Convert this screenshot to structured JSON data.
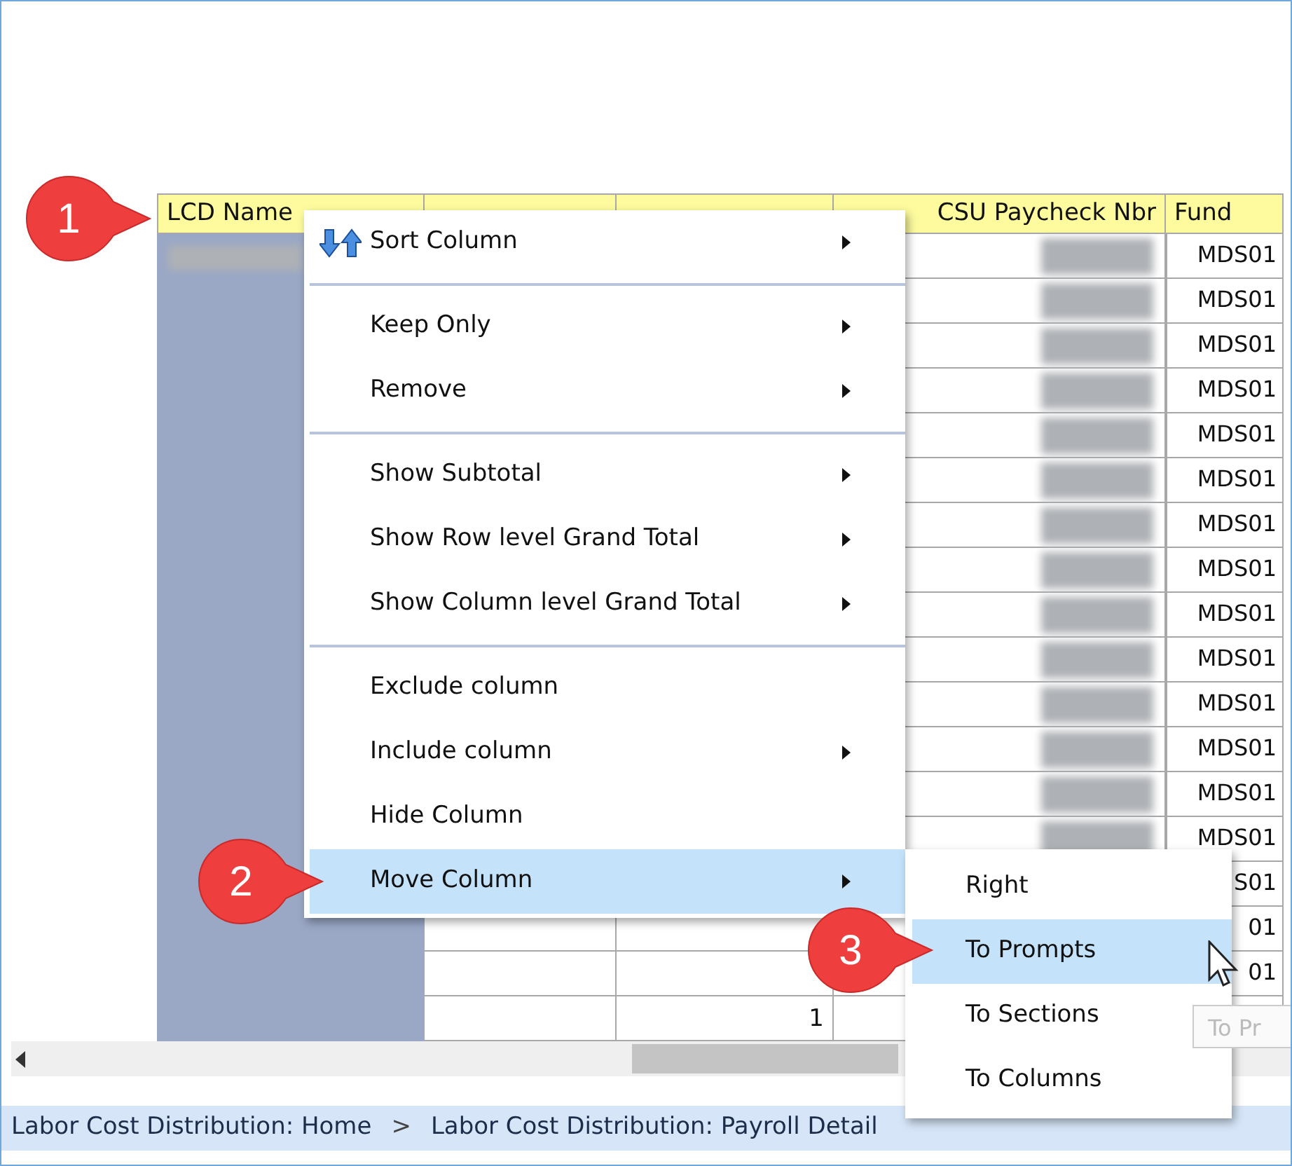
{
  "table": {
    "columns": [
      {
        "label": "LCD Name"
      },
      {},
      {},
      {
        "label": "CSU Paycheck Nbr"
      },
      {
        "label": "Fund"
      }
    ],
    "rows": [
      {
        "name_redacted": true,
        "paycheck_redacted": true,
        "fund": "MDS01"
      },
      {
        "paycheck_redacted": true,
        "fund": "MDS01"
      },
      {
        "paycheck_redacted": true,
        "fund": "MDS01"
      },
      {
        "paycheck_redacted": true,
        "fund": "MDS01"
      },
      {
        "paycheck_redacted": true,
        "fund": "MDS01"
      },
      {
        "paycheck_redacted": true,
        "fund": "MDS01"
      },
      {
        "paycheck_redacted": true,
        "fund": "MDS01"
      },
      {
        "paycheck_redacted": true,
        "fund": "MDS01"
      },
      {
        "paycheck_redacted": true,
        "fund": "MDS01"
      },
      {
        "paycheck_redacted": true,
        "fund": "MDS01"
      },
      {
        "paycheck_redacted": true,
        "fund": "MDS01"
      },
      {
        "paycheck_redacted": true,
        "fund": "MDS01"
      },
      {
        "paycheck_redacted": true,
        "fund": "MDS01"
      },
      {
        "paycheck_redacted": true,
        "fund": "MDS01"
      },
      {
        "fund": "S01"
      },
      {
        "fund": "01"
      },
      {
        "fund": "01"
      },
      {
        "column_3": "1"
      }
    ]
  },
  "context_menu": {
    "items": [
      {
        "kind": "sort_item",
        "label": "Sort Column",
        "has_submenu": true,
        "selected": false
      },
      {
        "kind": "separator"
      },
      {
        "kind": "item",
        "label": "Keep Only",
        "has_submenu": true,
        "selected": false
      },
      {
        "kind": "item",
        "label": "Remove",
        "has_submenu": true,
        "selected": false
      },
      {
        "kind": "separator"
      },
      {
        "kind": "item",
        "label": "Show Subtotal",
        "has_submenu": true,
        "selected": false
      },
      {
        "kind": "item",
        "label": "Show Row level Grand Total",
        "has_submenu": true,
        "selected": false
      },
      {
        "kind": "item",
        "label": "Show Column level Grand Total",
        "has_submenu": true,
        "selected": false
      },
      {
        "kind": "separator"
      },
      {
        "kind": "item",
        "label": "Exclude column",
        "has_submenu": false,
        "selected": false
      },
      {
        "kind": "item",
        "label": "Include column",
        "has_submenu": true,
        "selected": false
      },
      {
        "kind": "item",
        "label": "Hide Column",
        "has_submenu": false,
        "selected": false
      },
      {
        "kind": "item",
        "label": "Move Column",
        "has_submenu": true,
        "selected": true
      }
    ]
  },
  "submenu": {
    "items": [
      {
        "label": "Right",
        "selected": false
      },
      {
        "label": "To Prompts",
        "selected": true
      },
      {
        "label": "To Sections",
        "selected": false
      },
      {
        "label": "To Columns",
        "selected": false
      }
    ]
  },
  "tooltip": "To Pr",
  "callouts": [
    "1",
    "2",
    "3"
  ],
  "breadcrumb": [
    {
      "kind": "link",
      "label": "Labor Cost Distribution: Home"
    },
    {
      "kind": "sep",
      "label": ">"
    },
    {
      "kind": "link",
      "label": "Labor Cost Distribution: Payroll Detail"
    }
  ]
}
